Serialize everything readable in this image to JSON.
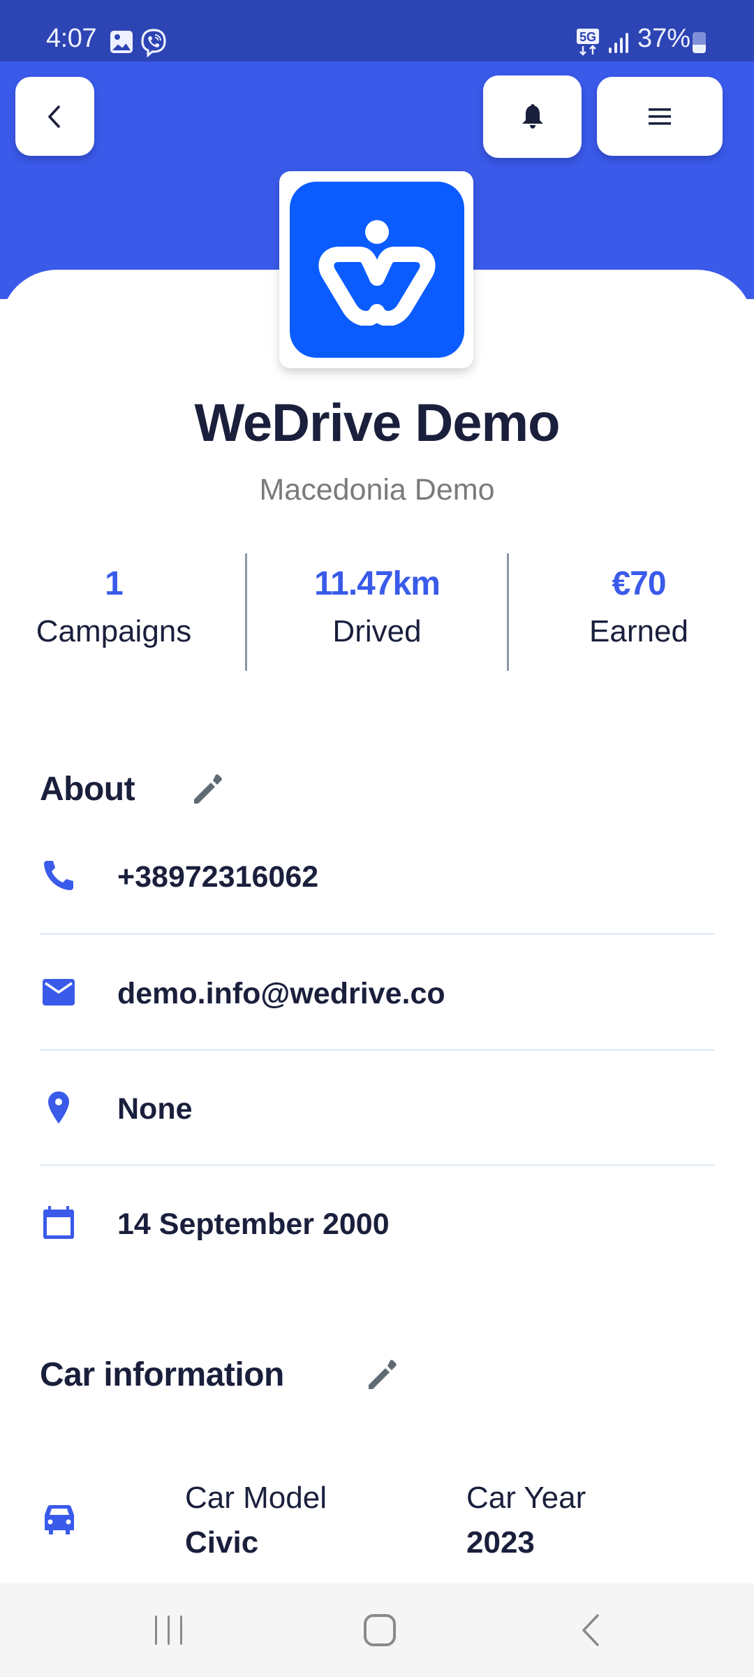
{
  "status_bar": {
    "time": "4:07",
    "notification_icons": [
      "gallery-icon",
      "viber-icon"
    ],
    "network": "5G",
    "battery_percent": "37%"
  },
  "header": {
    "back_icon": "chevron-left-icon",
    "notifications_icon": "bell-icon",
    "menu_icon": "hamburger-menu-icon"
  },
  "profile": {
    "logo": "wedrive-logo",
    "name": "WeDrive Demo",
    "subtitle": "Macedonia Demo"
  },
  "stats": [
    {
      "value": "1",
      "label": "Campaigns"
    },
    {
      "value": "11.47km",
      "label": "Drived"
    },
    {
      "value": "€70",
      "label": "Earned"
    }
  ],
  "about": {
    "title": "About",
    "edit_icon": "pencil-icon",
    "items": [
      {
        "icon": "phone-icon",
        "value": "+38972316062"
      },
      {
        "icon": "email-icon",
        "value": "demo.info@wedrive.co"
      },
      {
        "icon": "location-pin-icon",
        "value": "None"
      },
      {
        "icon": "calendar-icon",
        "value": "14 September 2000"
      }
    ]
  },
  "car_information": {
    "title": "Car information",
    "edit_icon": "pencil-icon",
    "icon": "car-icon",
    "fields": [
      {
        "label": "Car Model",
        "value": "Civic"
      },
      {
        "label": "Car Year",
        "value": "2023"
      }
    ]
  },
  "nav_bar": {
    "buttons": [
      "recent-apps",
      "home",
      "back"
    ]
  },
  "colors": {
    "status_bar": "#2D44B4",
    "header": "#3A5AEA",
    "accent": "#3A5AEA",
    "logo_bg": "#0A5CFF",
    "text_primary": "#1A1F3C",
    "text_secondary": "#7A7A7A",
    "edit_icon": "#5F6B73",
    "divider": "#E8EEF6",
    "nav_bar": "#F5F5F5"
  }
}
